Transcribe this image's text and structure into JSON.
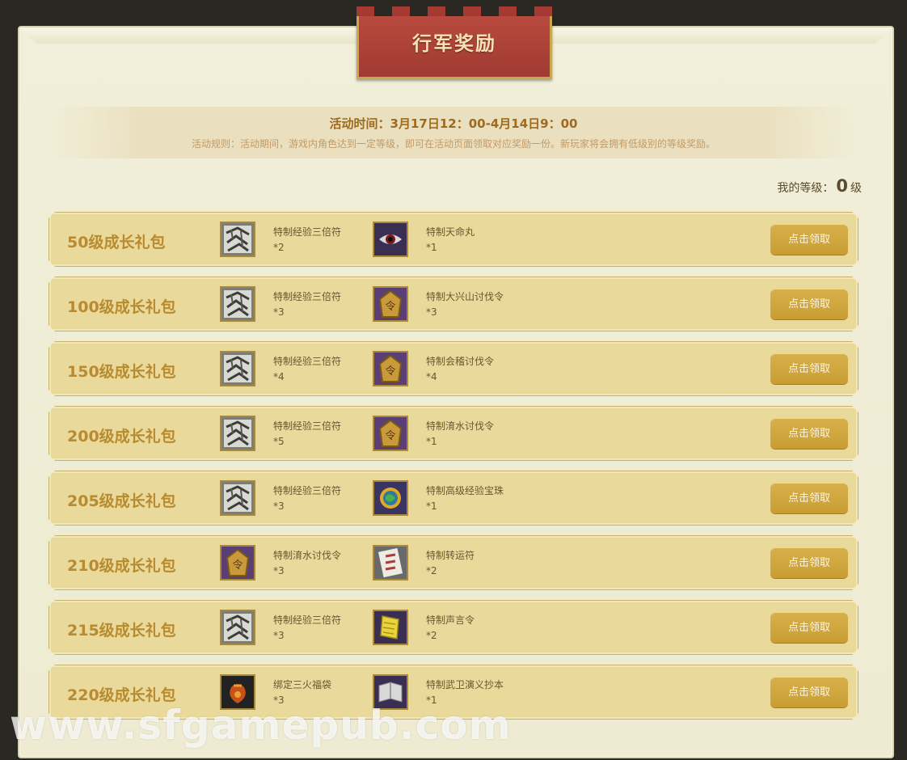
{
  "banner": {
    "title": "行军奖励"
  },
  "info": {
    "time": "活动时间：3月17日12：00-4月14日9：00",
    "rules": "活动规则：活动期间，游戏内角色达到一定等级，即可在活动页面领取对应奖励一份。新玩家将会拥有低级别的等级奖励。"
  },
  "my_level": {
    "label": "我的等级：",
    "value": "0",
    "unit": "级"
  },
  "packages": [
    {
      "name": "50级成长礼包",
      "items": [
        {
          "name": "特制经验三倍符",
          "count": "*2",
          "icon": "exp-scroll-icon"
        },
        {
          "name": "特制天命丸",
          "count": "*1",
          "icon": "eye-pill-icon"
        }
      ],
      "button": "点击领取"
    },
    {
      "name": "100级成长礼包",
      "items": [
        {
          "name": "特制经验三倍符",
          "count": "*3",
          "icon": "exp-scroll-icon"
        },
        {
          "name": "特制大兴山讨伐令",
          "count": "*3",
          "icon": "token-icon"
        }
      ],
      "button": "点击领取"
    },
    {
      "name": "150级成长礼包",
      "items": [
        {
          "name": "特制经验三倍符",
          "count": "*4",
          "icon": "exp-scroll-icon"
        },
        {
          "name": "特制会稽讨伐令",
          "count": "*4",
          "icon": "token-icon"
        }
      ],
      "button": "点击领取"
    },
    {
      "name": "200级成长礼包",
      "items": [
        {
          "name": "特制经验三倍符",
          "count": "*5",
          "icon": "exp-scroll-icon"
        },
        {
          "name": "特制淯水讨伐令",
          "count": "*1",
          "icon": "token-icon"
        }
      ],
      "button": "点击领取"
    },
    {
      "name": "205级成长礼包",
      "items": [
        {
          "name": "特制经验三倍符",
          "count": "*3",
          "icon": "exp-scroll-icon"
        },
        {
          "name": "特制高级经验宝珠",
          "count": "*1",
          "icon": "orb-icon"
        }
      ],
      "button": "点击领取"
    },
    {
      "name": "210级成长礼包",
      "items": [
        {
          "name": "特制淯水讨伐令",
          "count": "*3",
          "icon": "token-icon"
        },
        {
          "name": "特制转运符",
          "count": "*2",
          "icon": "luck-talisman-icon"
        }
      ],
      "button": "点击领取"
    },
    {
      "name": "215级成长礼包",
      "items": [
        {
          "name": "特制经验三倍符",
          "count": "*3",
          "icon": "exp-scroll-icon"
        },
        {
          "name": "特制声言令",
          "count": "*2",
          "icon": "yellow-scroll-icon"
        }
      ],
      "button": "点击领取"
    },
    {
      "name": "220级成长礼包",
      "items": [
        {
          "name": "绑定三火福袋",
          "count": "*3",
          "icon": "fortune-bag-icon"
        },
        {
          "name": "特制武卫演义抄本",
          "count": "*1",
          "icon": "book-icon"
        }
      ],
      "button": "点击领取"
    }
  ],
  "watermark": "www.sfgamepub.com"
}
